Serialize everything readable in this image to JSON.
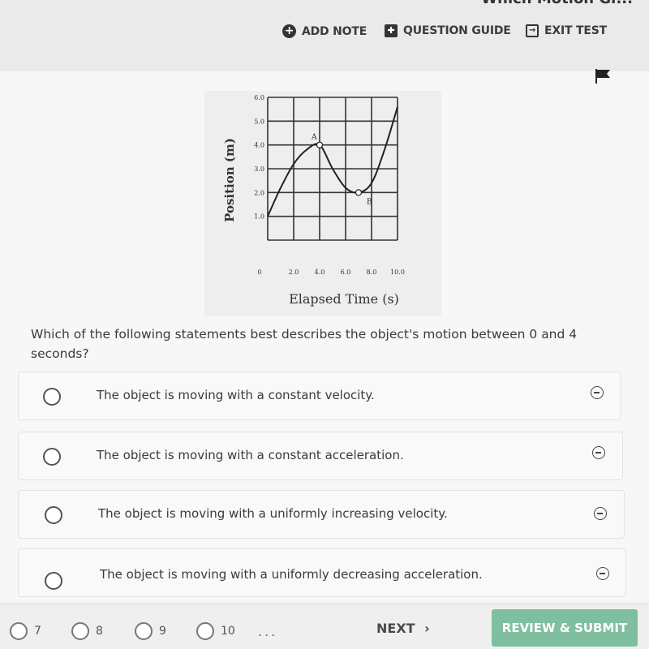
{
  "header": {
    "title_partial": "Which Motion Gr...",
    "add_note": "ADD NOTE",
    "question_guide": "QUESTION GUIDE",
    "exit_test": "EXIT TEST"
  },
  "chart_data": {
    "type": "line",
    "title": "",
    "xlabel": "Elapsed Time (s)",
    "ylabel": "Position (m)",
    "xlim": [
      0,
      10
    ],
    "ylim": [
      0,
      6
    ],
    "x_ticks": [
      "0",
      "2.0",
      "4.0",
      "6.0",
      "8.0",
      "10.0"
    ],
    "y_ticks": [
      "1.0",
      "2.0",
      "3.0",
      "4.0",
      "5.0",
      "6.0"
    ],
    "grid": true,
    "series": [
      {
        "name": "position",
        "x": [
          0,
          1,
          2,
          3,
          4,
          5,
          6,
          7,
          8,
          9,
          10
        ],
        "y": [
          1.0,
          2.2,
          3.2,
          3.8,
          4.0,
          3.0,
          2.2,
          2.0,
          2.4,
          3.8,
          5.6
        ]
      }
    ],
    "annotations": [
      {
        "label": "A",
        "x": 4.0,
        "y": 4.0
      },
      {
        "label": "B",
        "x": 7.0,
        "y": 2.0
      }
    ]
  },
  "question": {
    "text": "Which of the following statements best describes the object's motion between 0 and 4 seconds?",
    "options": [
      {
        "label": "The object is moving with a constant velocity."
      },
      {
        "label": "The object is moving with a constant acceleration."
      },
      {
        "label": "The object is moving with a uniformly increasing velocity."
      },
      {
        "label": "The object is moving with a uniformly decreasing acceleration."
      }
    ]
  },
  "footer": {
    "questions": [
      "7",
      "8",
      "9",
      "10"
    ],
    "ellipsis": "...",
    "next": "NEXT",
    "next_icon": "›",
    "review_submit": "REVIEW & SUBMIT"
  }
}
